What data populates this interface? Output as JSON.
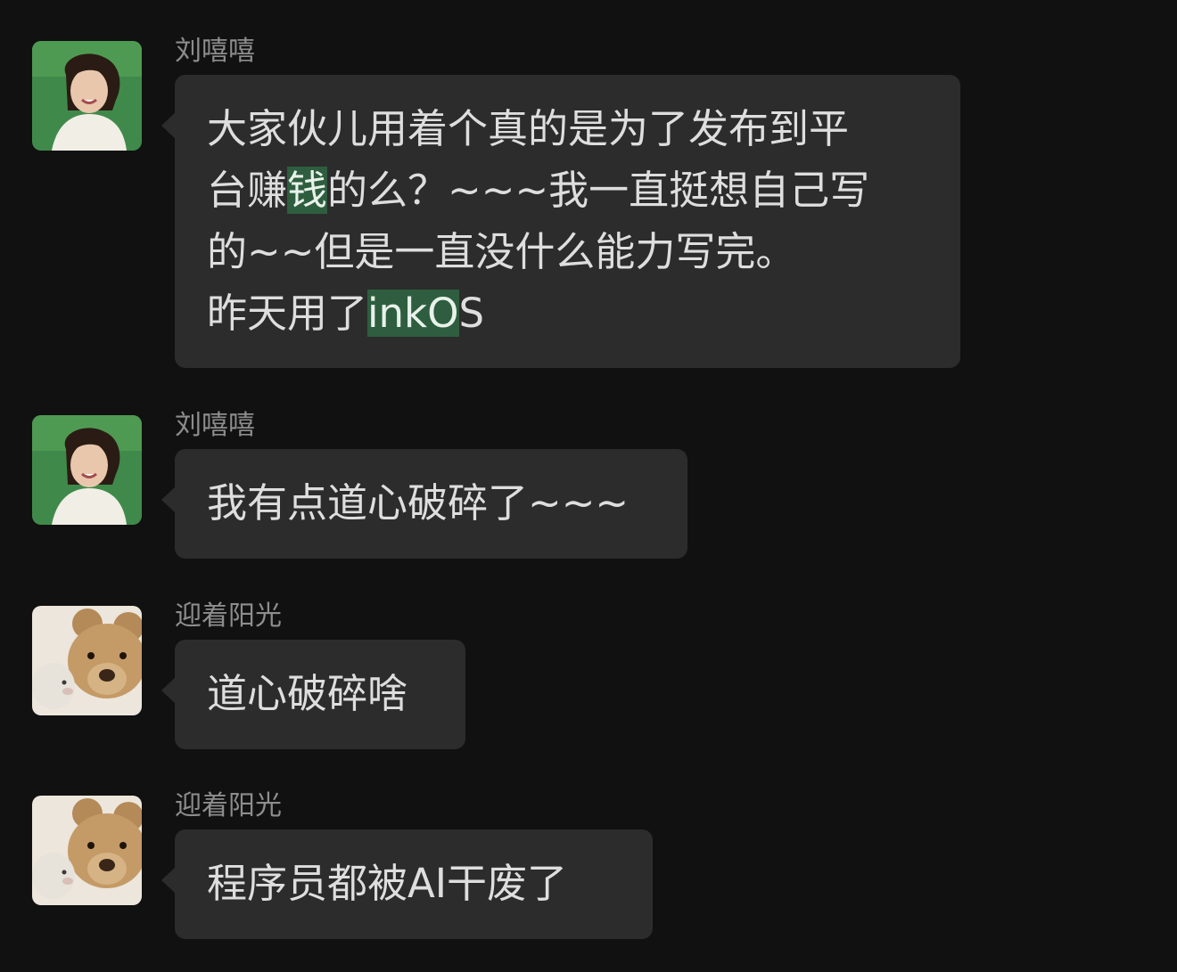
{
  "messages": [
    {
      "sender": "刘嘻嘻",
      "avatar": "girl-photo-avatar",
      "lines": [
        {
          "parts": [
            {
              "t": "大家伙儿用着个真的是为了发布到平",
              "hl": false
            }
          ]
        },
        {
          "parts": [
            {
              "t": "台赚",
              "hl": false
            },
            {
              "t": "钱",
              "hl": true
            },
            {
              "t": "的么？~~~我一直挺想自己写",
              "hl": false
            }
          ]
        },
        {
          "parts": [
            {
              "t": "的~~但是一直没什么能力写完。",
              "hl": false
            }
          ]
        },
        {
          "parts": [
            {
              "t": "昨天用了",
              "hl": false
            },
            {
              "t": "inkO",
              "hl": true
            },
            {
              "t": "S",
              "hl": false
            }
          ]
        }
      ]
    },
    {
      "sender": "刘嘻嘻",
      "avatar": "girl-photo-avatar",
      "lines": [
        {
          "parts": [
            {
              "t": "我有点道心破碎了~~~",
              "hl": false
            }
          ]
        }
      ]
    },
    {
      "sender": "迎着阳光",
      "avatar": "teddy-bear-avatar",
      "lines": [
        {
          "parts": [
            {
              "t": "道心破碎啥",
              "hl": false
            }
          ]
        }
      ]
    },
    {
      "sender": "迎着阳光",
      "avatar": "teddy-bear-avatar",
      "lines": [
        {
          "parts": [
            {
              "t": "程序员都被AI干废了",
              "hl": false
            }
          ]
        }
      ]
    }
  ],
  "colors": {
    "background": "#111111",
    "bubble": "#2c2c2c",
    "highlight": "#2e5e3f",
    "sender_text": "#8d8d8d",
    "message_text": "#dedede"
  }
}
